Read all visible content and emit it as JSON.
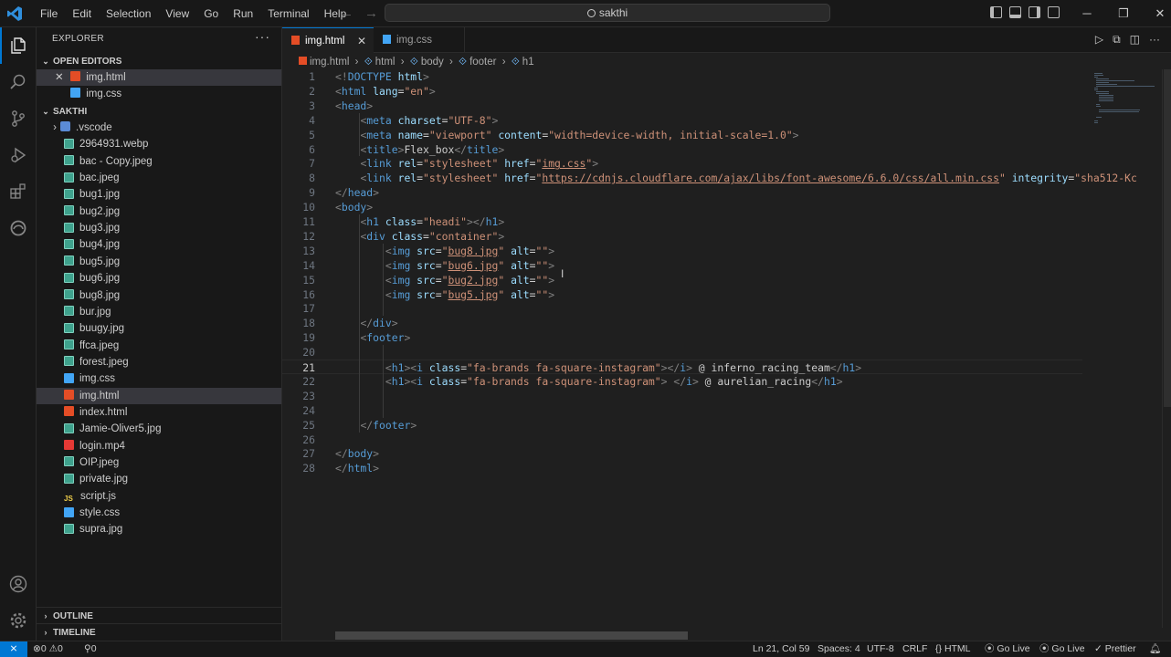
{
  "titlebar": {
    "menu": [
      "File",
      "Edit",
      "Selection",
      "View",
      "Go",
      "Run",
      "Terminal",
      "Help"
    ],
    "search": "sakthi"
  },
  "explorer": {
    "title": "EXPLORER",
    "open_editors_label": "OPEN EDITORS",
    "open_editors": [
      "img.html",
      "img.css"
    ],
    "folder_label": "SAKTHI",
    "files": [
      {
        "name": ".vscode",
        "type": "fold"
      },
      {
        "name": "2964931.webp",
        "type": "img"
      },
      {
        "name": "bac - Copy.jpeg",
        "type": "img"
      },
      {
        "name": "bac.jpeg",
        "type": "img"
      },
      {
        "name": "bug1.jpg",
        "type": "img"
      },
      {
        "name": "bug2.jpg",
        "type": "img"
      },
      {
        "name": "bug3.jpg",
        "type": "img"
      },
      {
        "name": "bug4.jpg",
        "type": "img"
      },
      {
        "name": "bug5.jpg",
        "type": "img"
      },
      {
        "name": "bug6.jpg",
        "type": "img"
      },
      {
        "name": "bug8.jpg",
        "type": "img"
      },
      {
        "name": "bur.jpg",
        "type": "img"
      },
      {
        "name": "buugy.jpg",
        "type": "img"
      },
      {
        "name": "ffca.jpeg",
        "type": "img"
      },
      {
        "name": "forest.jpeg",
        "type": "img"
      },
      {
        "name": "img.css",
        "type": "css"
      },
      {
        "name": "img.html",
        "type": "html"
      },
      {
        "name": "index.html",
        "type": "html"
      },
      {
        "name": "Jamie-Oliver5.jpg",
        "type": "img"
      },
      {
        "name": "login.mp4",
        "type": "mp4"
      },
      {
        "name": "OIP.jpeg",
        "type": "img"
      },
      {
        "name": "private.jpg",
        "type": "img"
      },
      {
        "name": "script.js",
        "type": "js"
      },
      {
        "name": "style.css",
        "type": "css"
      },
      {
        "name": "supra.jpg",
        "type": "img"
      }
    ],
    "outline_label": "OUTLINE",
    "timeline_label": "TIMELINE"
  },
  "tabs": [
    {
      "label": "img.html",
      "active": true
    },
    {
      "label": "img.css",
      "active": false
    }
  ],
  "breadcrumb": [
    "img.html",
    "html",
    "body",
    "footer",
    "h1"
  ],
  "editor": {
    "current_line": 21,
    "lines": [
      [
        [
          "t",
          "<!"
        ],
        [
          "tg",
          "DOCTYPE"
        ],
        [
          "c",
          " "
        ],
        [
          "at",
          "html"
        ],
        [
          "t",
          ">"
        ]
      ],
      [
        [
          "t",
          "<"
        ],
        [
          "tg",
          "html"
        ],
        [
          "c",
          " "
        ],
        [
          "at",
          "lang"
        ],
        [
          "c",
          "="
        ],
        [
          "st",
          "\"en\""
        ],
        [
          "t",
          ">"
        ]
      ],
      [
        [
          "t",
          "<"
        ],
        [
          "tg",
          "head"
        ],
        [
          "t",
          ">"
        ]
      ],
      [
        [
          "c",
          "    "
        ],
        [
          "t",
          "<"
        ],
        [
          "tg",
          "meta"
        ],
        [
          "c",
          " "
        ],
        [
          "at",
          "charset"
        ],
        [
          "c",
          "="
        ],
        [
          "st",
          "\"UTF-8\""
        ],
        [
          "t",
          ">"
        ]
      ],
      [
        [
          "c",
          "    "
        ],
        [
          "t",
          "<"
        ],
        [
          "tg",
          "meta"
        ],
        [
          "c",
          " "
        ],
        [
          "at",
          "name"
        ],
        [
          "c",
          "="
        ],
        [
          "st",
          "\"viewport\""
        ],
        [
          "c",
          " "
        ],
        [
          "at",
          "content"
        ],
        [
          "c",
          "="
        ],
        [
          "st",
          "\"width=device-width, initial-scale=1.0\""
        ],
        [
          "t",
          ">"
        ]
      ],
      [
        [
          "c",
          "    "
        ],
        [
          "t",
          "<"
        ],
        [
          "tg",
          "title"
        ],
        [
          "t",
          ">"
        ],
        [
          "c",
          "Flex_box"
        ],
        [
          "t",
          "</"
        ],
        [
          "tg",
          "title"
        ],
        [
          "t",
          ">"
        ]
      ],
      [
        [
          "c",
          "    "
        ],
        [
          "t",
          "<"
        ],
        [
          "tg",
          "link"
        ],
        [
          "c",
          " "
        ],
        [
          "at",
          "rel"
        ],
        [
          "c",
          "="
        ],
        [
          "st",
          "\"stylesheet\""
        ],
        [
          "c",
          " "
        ],
        [
          "at",
          "href"
        ],
        [
          "c",
          "="
        ],
        [
          "st",
          "\""
        ],
        [
          "stu",
          "img.css"
        ],
        [
          "st",
          "\""
        ],
        [
          "t",
          ">"
        ]
      ],
      [
        [
          "c",
          "    "
        ],
        [
          "t",
          "<"
        ],
        [
          "tg",
          "link"
        ],
        [
          "c",
          " "
        ],
        [
          "at",
          "rel"
        ],
        [
          "c",
          "="
        ],
        [
          "st",
          "\"stylesheet\""
        ],
        [
          "c",
          " "
        ],
        [
          "at",
          "href"
        ],
        [
          "c",
          "="
        ],
        [
          "st",
          "\""
        ],
        [
          "stu",
          "https://cdnjs.cloudflare.com/ajax/libs/font-awesome/6.6.0/css/all.min.css"
        ],
        [
          "st",
          "\""
        ],
        [
          "c",
          " "
        ],
        [
          "at",
          "integrity"
        ],
        [
          "c",
          "="
        ],
        [
          "st",
          "\"sha512-Kc"
        ]
      ],
      [
        [
          "t",
          "</"
        ],
        [
          "tg",
          "head"
        ],
        [
          "t",
          ">"
        ]
      ],
      [
        [
          "t",
          "<"
        ],
        [
          "tg",
          "body"
        ],
        [
          "t",
          ">"
        ]
      ],
      [
        [
          "c",
          "    "
        ],
        [
          "t",
          "<"
        ],
        [
          "tg",
          "h1"
        ],
        [
          "c",
          " "
        ],
        [
          "at",
          "class"
        ],
        [
          "c",
          "="
        ],
        [
          "st",
          "\"headi\""
        ],
        [
          "t",
          "></"
        ],
        [
          "tg",
          "h1"
        ],
        [
          "t",
          ">"
        ]
      ],
      [
        [
          "c",
          "    "
        ],
        [
          "t",
          "<"
        ],
        [
          "tg",
          "div"
        ],
        [
          "c",
          " "
        ],
        [
          "at",
          "class"
        ],
        [
          "c",
          "="
        ],
        [
          "st",
          "\"container\""
        ],
        [
          "t",
          ">"
        ]
      ],
      [
        [
          "c",
          "        "
        ],
        [
          "t",
          "<"
        ],
        [
          "tg",
          "img"
        ],
        [
          "c",
          " "
        ],
        [
          "at",
          "src"
        ],
        [
          "c",
          "="
        ],
        [
          "st",
          "\""
        ],
        [
          "stu",
          "bug8.jpg"
        ],
        [
          "st",
          "\""
        ],
        [
          "c",
          " "
        ],
        [
          "at",
          "alt"
        ],
        [
          "c",
          "="
        ],
        [
          "st",
          "\"\""
        ],
        [
          "t",
          ">"
        ]
      ],
      [
        [
          "c",
          "        "
        ],
        [
          "t",
          "<"
        ],
        [
          "tg",
          "img"
        ],
        [
          "c",
          " "
        ],
        [
          "at",
          "src"
        ],
        [
          "c",
          "="
        ],
        [
          "st",
          "\""
        ],
        [
          "stu",
          "bug6.jpg"
        ],
        [
          "st",
          "\""
        ],
        [
          "c",
          " "
        ],
        [
          "at",
          "alt"
        ],
        [
          "c",
          "="
        ],
        [
          "st",
          "\"\""
        ],
        [
          "t",
          ">"
        ]
      ],
      [
        [
          "c",
          "        "
        ],
        [
          "t",
          "<"
        ],
        [
          "tg",
          "img"
        ],
        [
          "c",
          " "
        ],
        [
          "at",
          "src"
        ],
        [
          "c",
          "="
        ],
        [
          "st",
          "\""
        ],
        [
          "stu",
          "bug2.jpg"
        ],
        [
          "st",
          "\""
        ],
        [
          "c",
          " "
        ],
        [
          "at",
          "alt"
        ],
        [
          "c",
          "="
        ],
        [
          "st",
          "\"\""
        ],
        [
          "t",
          ">"
        ]
      ],
      [
        [
          "c",
          "        "
        ],
        [
          "t",
          "<"
        ],
        [
          "tg",
          "img"
        ],
        [
          "c",
          " "
        ],
        [
          "at",
          "src"
        ],
        [
          "c",
          "="
        ],
        [
          "st",
          "\""
        ],
        [
          "stu",
          "bug5.jpg"
        ],
        [
          "st",
          "\""
        ],
        [
          "c",
          " "
        ],
        [
          "at",
          "alt"
        ],
        [
          "c",
          "="
        ],
        [
          "st",
          "\"\""
        ],
        [
          "t",
          ">"
        ]
      ],
      [],
      [
        [
          "c",
          "    "
        ],
        [
          "t",
          "</"
        ],
        [
          "tg",
          "div"
        ],
        [
          "t",
          ">"
        ]
      ],
      [
        [
          "c",
          "    "
        ],
        [
          "t",
          "<"
        ],
        [
          "tg",
          "footer"
        ],
        [
          "t",
          ">"
        ]
      ],
      [],
      [
        [
          "c",
          "        "
        ],
        [
          "t",
          "<"
        ],
        [
          "tg",
          "h1"
        ],
        [
          "t",
          "><"
        ],
        [
          "tg",
          "i"
        ],
        [
          "c",
          " "
        ],
        [
          "at",
          "class"
        ],
        [
          "c",
          "="
        ],
        [
          "st",
          "\"fa-brands fa-square-instagram\""
        ],
        [
          "t",
          "></"
        ],
        [
          "tg",
          "i"
        ],
        [
          "t",
          ">"
        ],
        [
          "c",
          " @ inferno_racing_team"
        ],
        [
          "t",
          "</"
        ],
        [
          "tg",
          "h1"
        ],
        [
          "t",
          ">"
        ]
      ],
      [
        [
          "c",
          "        "
        ],
        [
          "t",
          "<"
        ],
        [
          "tg",
          "h1"
        ],
        [
          "t",
          "><"
        ],
        [
          "tg",
          "i"
        ],
        [
          "c",
          " "
        ],
        [
          "at",
          "class"
        ],
        [
          "c",
          "="
        ],
        [
          "st",
          "\"fa-brands fa-square-instagram\""
        ],
        [
          "t",
          ">"
        ],
        [
          "c",
          " "
        ],
        [
          "t",
          "</"
        ],
        [
          "tg",
          "i"
        ],
        [
          "t",
          ">"
        ],
        [
          "c",
          " @ aurelian_racing"
        ],
        [
          "t",
          "</"
        ],
        [
          "tg",
          "h1"
        ],
        [
          "t",
          ">"
        ]
      ],
      [],
      [],
      [
        [
          "c",
          "    "
        ],
        [
          "t",
          "</"
        ],
        [
          "tg",
          "footer"
        ],
        [
          "t",
          ">"
        ]
      ],
      [],
      [
        [
          "t",
          "</"
        ],
        [
          "tg",
          "body"
        ],
        [
          "t",
          ">"
        ]
      ],
      [
        [
          "t",
          "</"
        ],
        [
          "tg",
          "html"
        ],
        [
          "t",
          ">"
        ]
      ]
    ]
  },
  "statusbar": {
    "errors": "0",
    "warnings": "0",
    "ports": "0",
    "position": "Ln 21, Col 59",
    "spaces": "Spaces: 4",
    "encoding": "UTF-8",
    "eol": "CRLF",
    "language": "HTML",
    "golive1": "Go Live",
    "golive2": "Go Live",
    "prettier": "Prettier"
  },
  "colors": {
    "accent": "#0078d4",
    "bg": "#1f1f1f",
    "sidebar": "#181818"
  }
}
